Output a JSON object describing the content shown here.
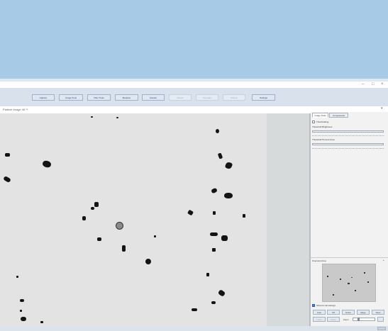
{
  "toolbar": {
    "buttons": [
      {
        "label": "Capture",
        "enabled": true
      },
      {
        "label": "Image Tools",
        "enabled": true
      },
      {
        "label": "Filter Tools",
        "enabled": true
      },
      {
        "label": "Measure",
        "enabled": true
      },
      {
        "label": "Acquire",
        "enabled": true
      },
      {
        "label": "Report",
        "enabled": false
      },
      {
        "label": "Compare",
        "enabled": false
      },
      {
        "label": "Archive",
        "enabled": false
      },
      {
        "label": "Settings",
        "enabled": true
      }
    ]
  },
  "path": {
    "text": "Particle Image 46 **"
  },
  "panel": {
    "tabs": [
      {
        "label": "Image Tools",
        "active": true
      },
      {
        "label": "Components",
        "active": false
      }
    ],
    "checkbox_label": "Thresholding",
    "slider1_label": "Threshold Brightness",
    "slider2_label": "Threshold Percent Area",
    "preview_label": "Overview Area",
    "options_label": "Show for all settings",
    "btn_row1": [
      "Auto",
      "Fill",
      "Holes",
      "Edge",
      "Save"
    ],
    "btn_row2": [
      "Undo",
      "Redo",
      "Zoom"
    ]
  },
  "colors": {
    "banner": "#a7cbe6",
    "toolbar": "#d8e1ec",
    "image_bg": "#e3e3e3"
  }
}
